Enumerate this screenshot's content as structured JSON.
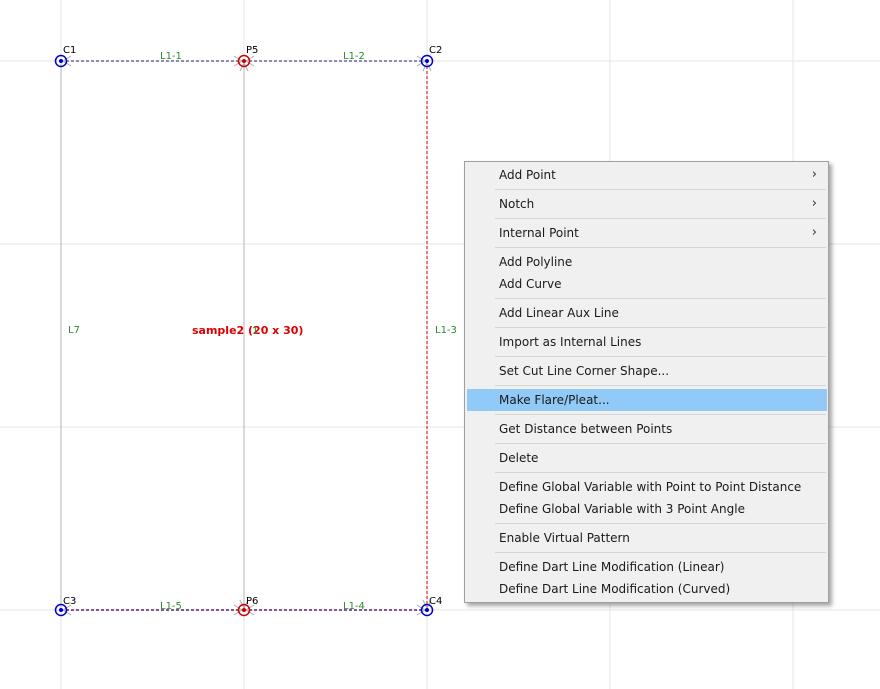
{
  "canvas": {
    "points": {
      "c1": "C1",
      "p5": "P5",
      "c2": "C2",
      "c3": "C3",
      "p6": "P6",
      "c4": "C4"
    },
    "lines": {
      "l1_1": "L1-1",
      "l1_2": "L1-2",
      "l1_3": "L1-3",
      "l1_4": "L1-4",
      "l1_5": "L1-5",
      "l7": "L7"
    },
    "pattern_name": "sample2 (20 x 30)",
    "overlap_digit": "1",
    "colors": {
      "grid": "#e6e6e6",
      "line_green": "#2e8b2e",
      "cut_red": "#d00000",
      "point_blue": "#0000cc"
    }
  },
  "context_menu": {
    "items": [
      {
        "label": "Add Point",
        "submenu": "›"
      },
      {
        "label": "Notch",
        "submenu": "›"
      },
      {
        "label": "Internal Point",
        "submenu": "›"
      },
      {
        "label": "Add Polyline"
      },
      {
        "label": "Add Curve"
      },
      {
        "label": "Add Linear Aux Line"
      },
      {
        "label": "Import as Internal Lines"
      },
      {
        "label": "Set Cut Line Corner Shape..."
      },
      {
        "label": "Make Flare/Pleat..."
      },
      {
        "label": "Get Distance between Points"
      },
      {
        "label": "Delete"
      },
      {
        "label": "Define Global Variable with Point to Point Distance"
      },
      {
        "label": "Define Global Variable with 3 Point Angle"
      },
      {
        "label": "Enable Virtual Pattern"
      },
      {
        "label": "Define Dart Line Modification (Linear)"
      },
      {
        "label": "Define Dart Line Modification (Curved)"
      }
    ],
    "selected": "Make Flare/Pleat..."
  }
}
